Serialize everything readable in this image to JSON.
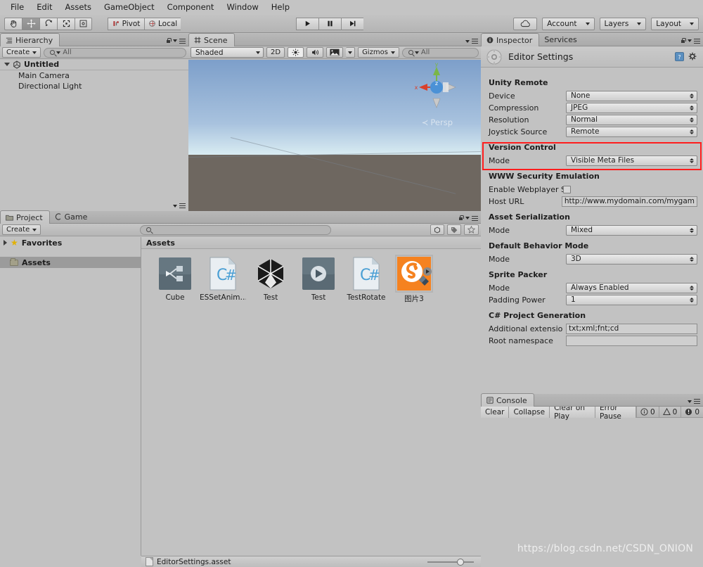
{
  "menubar": {
    "items": [
      "File",
      "Edit",
      "Assets",
      "GameObject",
      "Component",
      "Window",
      "Help"
    ]
  },
  "toolbar": {
    "transform_tools": [
      {
        "name": "hand-tool",
        "glyph": "✋",
        "selected": false
      },
      {
        "name": "move-tool",
        "glyph": "✥",
        "selected": true
      },
      {
        "name": "rotate-tool",
        "glyph": "↻",
        "selected": false
      },
      {
        "name": "scale-tool",
        "glyph": "⬌",
        "selected": false
      },
      {
        "name": "rect-tool",
        "glyph": "▣",
        "selected": false
      }
    ],
    "pivot_label": "Pivot",
    "local_label": "Local",
    "play_label": "▶",
    "pause_label": "▐▐",
    "step_label": "▶|",
    "cloud_label": "cloud-icon",
    "account_label": "Account",
    "layers_label": "Layers",
    "layout_label": "Layout"
  },
  "hierarchy": {
    "tab_label": "Hierarchy",
    "create_label": "Create",
    "search_placeholder": "All",
    "scene_name": "Untitled",
    "objects": [
      "Main Camera",
      "Directional Light"
    ]
  },
  "scene": {
    "tab_label": "Scene",
    "shading_mode": "Shaded",
    "two_d_label": "2D",
    "light_label": "light-icon",
    "audio_label": "audio-icon",
    "fx_label": "fx-icon",
    "gizmos_label": "Gizmos",
    "search_placeholder": "All",
    "perspective_label": "Persp",
    "axis_x": "x",
    "axis_y": "y",
    "axis_z": "z"
  },
  "project": {
    "tab_label": "Project",
    "game_tab_label": "Game",
    "create_label": "Create",
    "search_placeholder": "",
    "favorites_label": "Favorites",
    "assets_label": "Assets",
    "breadcrumb": "Assets",
    "items": [
      {
        "name": "Cube",
        "icon": "prefab-icon",
        "selected": false
      },
      {
        "name": "ESSetAnim…",
        "icon": "csharp-icon",
        "selected": false
      },
      {
        "name": "Test",
        "icon": "unity-scene-icon",
        "selected": false
      },
      {
        "name": "Test",
        "icon": "animation-icon",
        "selected": false
      },
      {
        "name": "TestRotate",
        "icon": "csharp-icon",
        "selected": false
      },
      {
        "name": "图片3",
        "icon": "sprite-icon",
        "selected": true
      }
    ]
  },
  "inspector": {
    "tab_label": "Inspector",
    "services_tab_label": "Services",
    "title": "Editor Settings",
    "help_label": "help-icon",
    "settings_label": "gear-icon",
    "sections": [
      {
        "heading": "Unity Remote",
        "fields": [
          {
            "label": "Device",
            "type": "popup",
            "value": "None"
          },
          {
            "label": "Compression",
            "type": "popup",
            "value": "JPEG"
          },
          {
            "label": "Resolution",
            "type": "popup",
            "value": "Normal"
          },
          {
            "label": "Joystick Source",
            "type": "popup",
            "value": "Remote"
          }
        ]
      },
      {
        "heading": "Version Control",
        "highlighted": true,
        "fields": [
          {
            "label": "Mode",
            "type": "popup",
            "value": "Visible Meta Files"
          }
        ]
      },
      {
        "heading": "WWW Security Emulation",
        "fields": [
          {
            "label": "Enable Webplayer S",
            "type": "checkbox",
            "value": false
          },
          {
            "label": "Host URL",
            "type": "text",
            "value": "http://www.mydomain.com/mygam"
          }
        ]
      },
      {
        "heading": "Asset Serialization",
        "fields": [
          {
            "label": "Mode",
            "type": "popup",
            "value": "Mixed"
          }
        ]
      },
      {
        "heading": "Default Behavior Mode",
        "fields": [
          {
            "label": "Mode",
            "type": "popup",
            "value": "3D"
          }
        ]
      },
      {
        "heading": "Sprite Packer",
        "fields": [
          {
            "label": "Mode",
            "type": "popup",
            "value": "Always Enabled"
          },
          {
            "label": "Padding Power",
            "type": "popup",
            "value": "1"
          }
        ]
      },
      {
        "heading": "C# Project Generation",
        "fields": [
          {
            "label": "Additional extensions",
            "type": "text",
            "value": "txt;xml;fnt;cd"
          },
          {
            "label": "Root namespace",
            "type": "text",
            "value": ""
          }
        ]
      }
    ]
  },
  "console": {
    "tab_label": "Console",
    "buttons": [
      "Clear",
      "Collapse",
      "Clear on Play",
      "Error Pause"
    ],
    "counts": [
      {
        "icon": "info-icon",
        "value": "0"
      },
      {
        "icon": "warning-icon",
        "value": "0"
      },
      {
        "icon": "error-icon",
        "value": "0"
      }
    ]
  },
  "statusbar": {
    "file_label": "EditorSettings.asset",
    "zoom_value": "64"
  },
  "watermark": "https://blog.csdn.net/CSDN_ONION",
  "colors": {
    "chrome": "#c2c2c2",
    "highlight_red": "#ff1d1d",
    "selection": "#9b9b9b",
    "sky_top": "#7d9fca",
    "ground": "#6e6760",
    "sprite_orange": "#f58220"
  }
}
